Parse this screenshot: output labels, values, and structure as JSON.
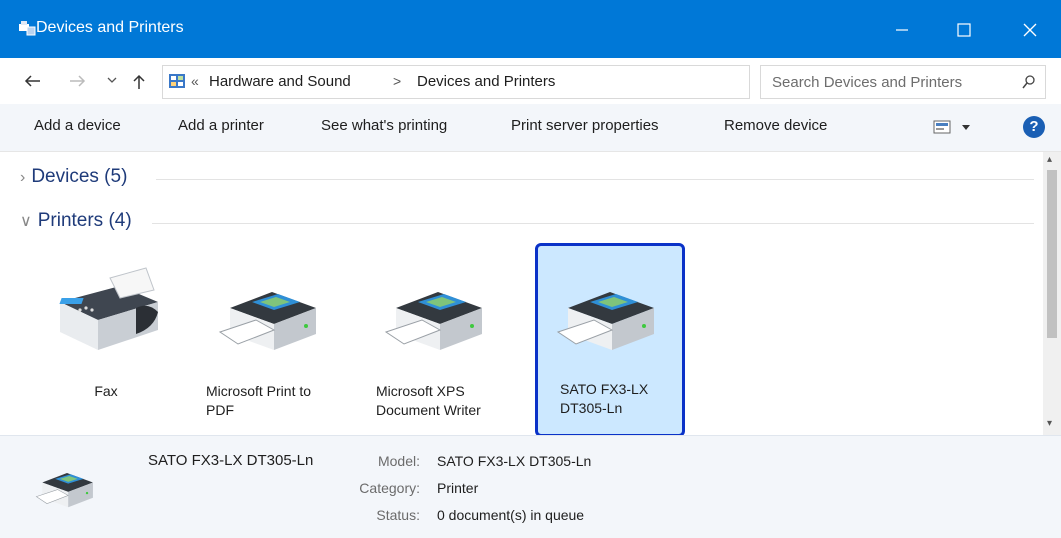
{
  "window": {
    "title": "Devices and Printers",
    "controls": [
      "minimize",
      "maximize",
      "close"
    ]
  },
  "address": {
    "overflow_glyph": "«",
    "breadcrumb": [
      "Hardware and Sound",
      "Devices and Printers"
    ],
    "separator": ">",
    "search_placeholder": "Search Devices and Printers"
  },
  "commands": {
    "add_device": "Add a device",
    "add_printer": "Add a printer",
    "see_printing": "See what's printing",
    "print_server": "Print server properties",
    "remove_device": "Remove device",
    "help": "?"
  },
  "groups": [
    {
      "label": "Devices (5)",
      "expanded": false
    },
    {
      "label": "Printers (4)",
      "expanded": true
    }
  ],
  "printers": [
    {
      "name_line1": "Fax",
      "name_line2": "",
      "icon": "fax-icon",
      "selected": false
    },
    {
      "name_line1": "Microsoft Print to",
      "name_line2": "PDF",
      "icon": "printer-icon",
      "selected": false
    },
    {
      "name_line1": "Microsoft XPS",
      "name_line2": "Document Writer",
      "icon": "printer-icon",
      "selected": false
    },
    {
      "name_line1": "SATO FX3-LX",
      "name_line2": "DT305-Ln",
      "icon": "printer-icon",
      "selected": true
    }
  ],
  "details": {
    "name": "SATO FX3-LX DT305-Ln",
    "model_label": "Model:",
    "model_value": "SATO FX3-LX DT305-Ln",
    "category_label": "Category:",
    "category_value": "Printer",
    "status_label": "Status:",
    "status_value": "0 document(s) in queue"
  },
  "colors": {
    "titlebar": "#0078d7",
    "selection_fill": "#cce8ff",
    "selection_border": "#0a32c8",
    "group_header": "#1f3b7a"
  }
}
